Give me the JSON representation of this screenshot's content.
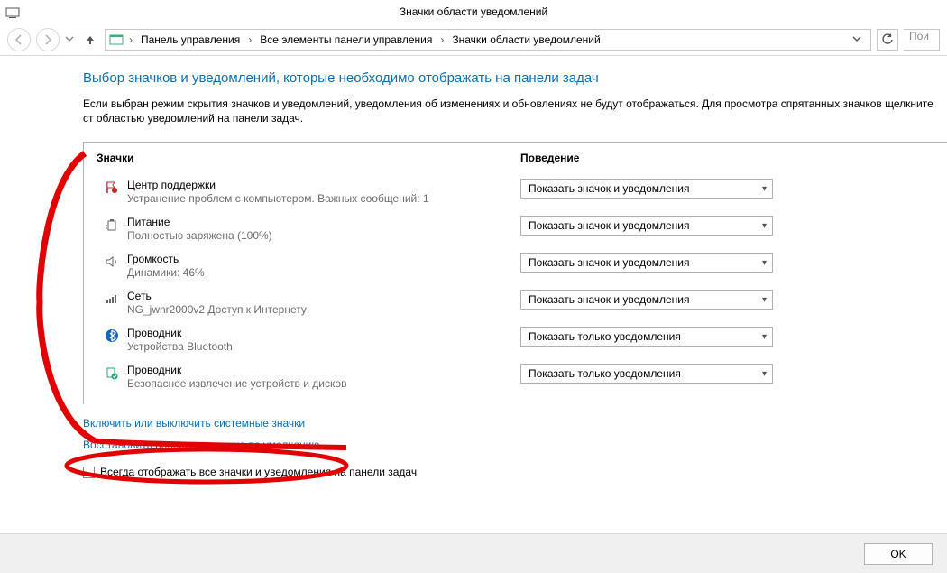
{
  "window": {
    "title": "Значки области уведомлений"
  },
  "breadcrumb": {
    "items": [
      "Панель управления",
      "Все элементы панели управления",
      "Значки области уведомлений"
    ],
    "search_placeholder": "Пои"
  },
  "page": {
    "heading": "Выбор значков и уведомлений, которые необходимо отображать на панели задач",
    "intro": "Если выбран режим скрытия значков и уведомлений, уведомления об изменениях и обновлениях не будут отображаться. Для просмотра спрятанных значков щелкните ст областью уведомлений на панели задач.",
    "col_icons": "Значки",
    "col_behavior": "Поведение"
  },
  "options": {
    "show_icon_and_notif": "Показать значок и уведомления",
    "show_notif_only": "Показать только уведомления"
  },
  "rows": [
    {
      "name": "Центр поддержки",
      "desc": "Устранение проблем с компьютером. Важных сообщений: 1",
      "selected": "show_icon_and_notif",
      "icon": "flag"
    },
    {
      "name": "Питание",
      "desc": "Полностью заряжена (100%)",
      "selected": "show_icon_and_notif",
      "icon": "battery"
    },
    {
      "name": "Громкость",
      "desc": "Динамики: 46%",
      "selected": "show_icon_and_notif",
      "icon": "volume"
    },
    {
      "name": "Сеть",
      "desc": "NG_jwnr2000v2 Доступ к Интернету",
      "selected": "show_icon_and_notif",
      "icon": "network"
    },
    {
      "name": "Проводник",
      "desc": "Устройства Bluetooth",
      "selected": "show_notif_only",
      "icon": "bluetooth"
    },
    {
      "name": "Проводник",
      "desc": "Безопасное извлечение устройств и дисков",
      "selected": "show_notif_only",
      "icon": "eject"
    }
  ],
  "links": {
    "system_icons": "Включить или выключить системные значки",
    "restore_defaults": "Восстановить поведение значка по умолчанию"
  },
  "checkbox": {
    "label": "Всегда отображать все значки и уведомления на панели задач"
  },
  "buttons": {
    "ok": "OK"
  }
}
